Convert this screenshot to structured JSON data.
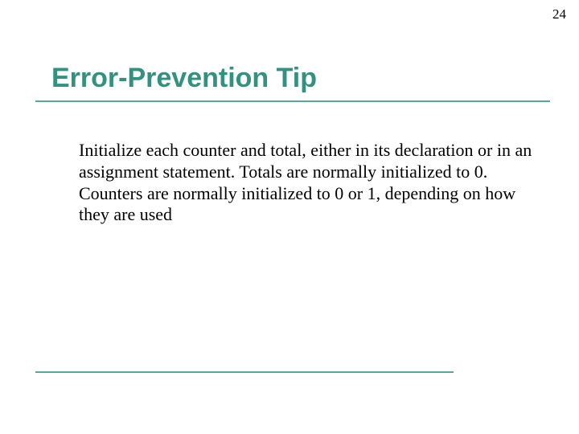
{
  "page_number": "24",
  "title": "Error-Prevention Tip",
  "body": "Initialize each counter and total, either in its declaration or in an assignment statement. Totals are normally initialized to 0. Counters are normally initialized to 0 or 1, depending on how they are used",
  "accent_color": "#5aa796",
  "title_color": "#339180"
}
